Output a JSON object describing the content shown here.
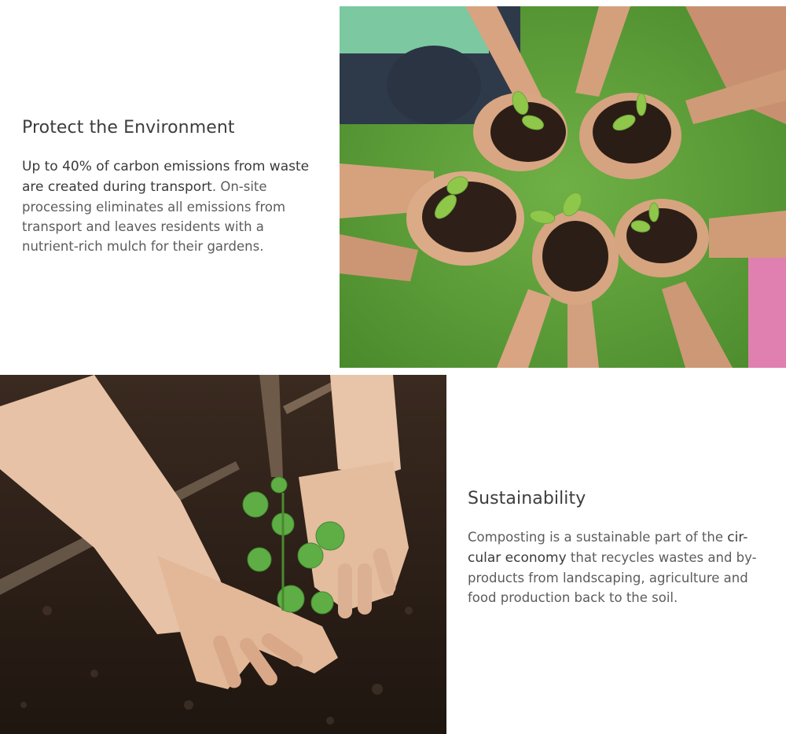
{
  "sections": [
    {
      "title": "Protect the Environment",
      "body_lead": "Up to 40% of carbon emissions from waste are created during transport",
      "body_lead_end": ".",
      "body_rest": " On-site processing eliminates all emissions from transport and leaves residents with a nutrient-rich mulch for their gardens."
    },
    {
      "title": "Sustainability",
      "body_part1": "Composting is a sustainable part of the ",
      "body_link": "cir-cular economy",
      "body_part2": " that recycles wastes and by-products from landscaping, agriculture and food production back to the soil."
    }
  ],
  "images": {
    "hands_soil": "hands-holding-soil-seedlings-photo",
    "planting": "hands-planting-seedling-photo"
  },
  "colors": {
    "heading": "#3d3d3d",
    "body": "#5c5c5c",
    "grass": "#5a9a3a",
    "soil": "#2a1e16"
  }
}
